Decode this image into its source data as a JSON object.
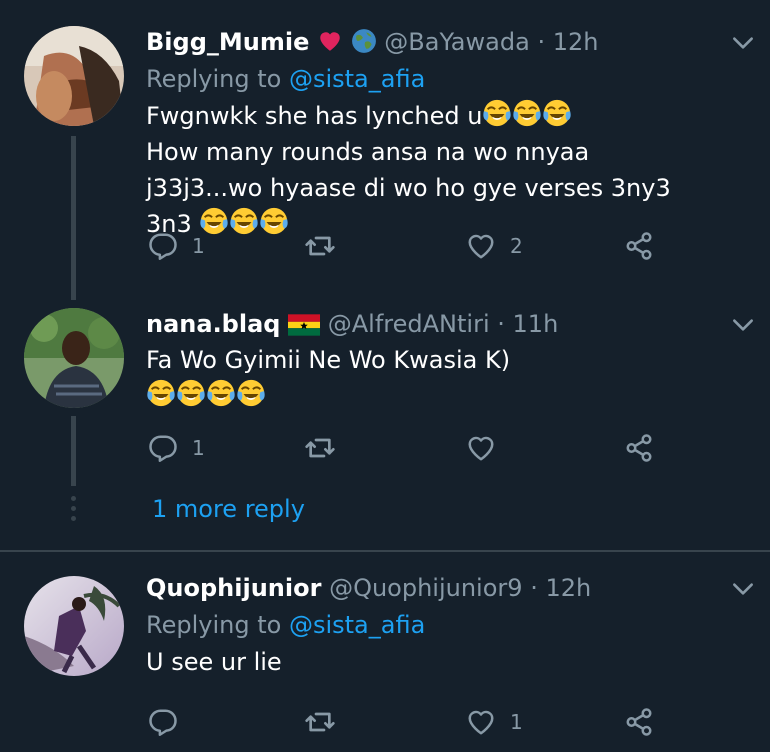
{
  "tweets": [
    {
      "name": "Bigg_Mumie",
      "name_emojis": [
        "red-heart",
        "globe"
      ],
      "handle": "@BaYawada",
      "dot": "·",
      "time": "12h",
      "replying_prefix": "Replying to",
      "replying_to": "@sista_afia",
      "line1": "Fwgnwkk she has lynched u",
      "line2": "How many rounds ansa na wo nnyaa j33j3...wo hyaase di wo ho gye verses 3ny3 3n3",
      "reply_count": "1",
      "like_count": "2"
    },
    {
      "name": "nana.blaq",
      "name_emojis": [
        "ghana-flag"
      ],
      "handle": "@AlfredANtiri",
      "dot": "·",
      "time": "11h",
      "line1": "Fa Wo Gyimii Ne Wo Kwasia K)",
      "reply_count": "1"
    },
    {
      "name": "Quophijunior",
      "handle": "@Quophijunior9",
      "dot": "·",
      "time": "12h",
      "replying_prefix": "Replying to",
      "replying_to": "@sista_afia",
      "line1": "U see ur lie",
      "like_count": "1"
    }
  ],
  "more_reply": "1 more reply",
  "icons": [
    "reply-icon",
    "retweet-icon",
    "like-icon",
    "share-icon",
    "chevron-down-icon",
    "tears-of-joy-emoji"
  ],
  "colors": {
    "background": "#15202b",
    "text": "#ffffff",
    "secondary": "#8899a6",
    "accent": "#1da1f2",
    "divider": "#38444d"
  }
}
